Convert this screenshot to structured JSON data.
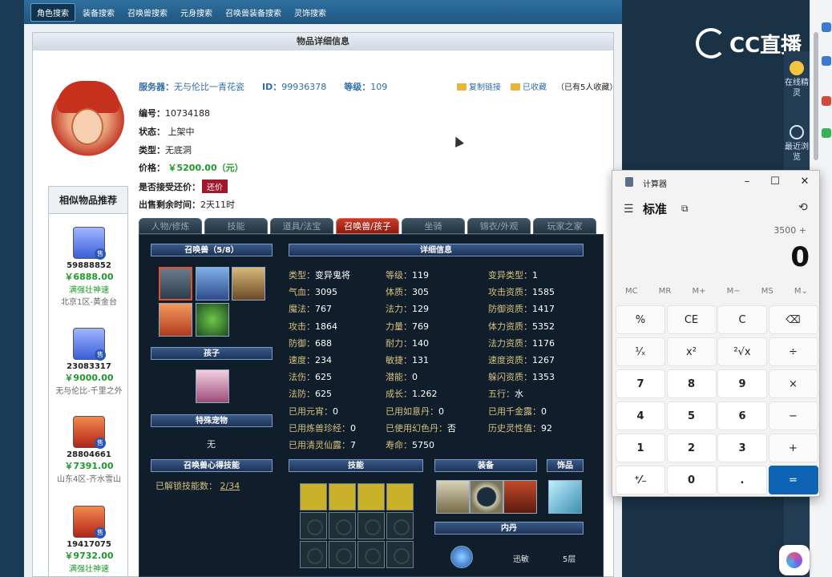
{
  "nav": {
    "tabs": [
      "角色搜索",
      "装备搜索",
      "召唤兽搜索",
      "元身搜索",
      "召唤兽装备搜索",
      "灵饰搜索"
    ],
    "active_index": 0
  },
  "panel": {
    "title": "物品详细信息"
  },
  "header": {
    "server_label": "服务器：",
    "server_value": "无与伦比一青花瓷",
    "id_label": "ID：",
    "id_value": "99936378",
    "level_label": "等级：",
    "level_value": "109",
    "copy_link": "复制链接",
    "favorited": "已收藏",
    "fav_count": "（已有5人收藏）"
  },
  "details": {
    "serial_label": "编号：",
    "serial_value": "10734188",
    "status_label": "状态：",
    "status_value": "上架中",
    "type_label": "类型：",
    "type_value": "无底洞",
    "price_label": "价格：",
    "price_value": "￥5200.00（元）",
    "bargain_label": "是否接受还价：",
    "bargain_button": "还价",
    "remaining_label": "出售剩余时间：",
    "remaining_value": "2天11时"
  },
  "similar": {
    "title": "相似物品推荐",
    "items": [
      {
        "id": "59888852",
        "price": "￥6888.00",
        "name": "满强壮神速",
        "server": "北京1区-黄金台"
      },
      {
        "id": "23083317",
        "price": "￥9000.00",
        "name": "",
        "server": "无与伦比-千里之外"
      },
      {
        "id": "28804661",
        "price": "￥7391.00",
        "name": "",
        "server": "山东4区-齐水雪山"
      },
      {
        "id": "19417075",
        "price": "￥9732.00",
        "name": "满强壮神速",
        "server": ""
      }
    ],
    "sell_badge": "售"
  },
  "game_tabs": [
    "人物/修炼",
    "技能",
    "道具/法宝",
    "召唤兽/孩子",
    "坐骑",
    "锦衣/外观",
    "玩家之家"
  ],
  "game_active_tab": 3,
  "sections": {
    "pets": "召唤兽（5/8）",
    "detail": "详细信息",
    "child": "孩子",
    "special_pet": "特殊宠物",
    "special_pet_value": "无",
    "pet_skill_head": "召唤兽心得技能",
    "unlocked_label": "已解锁技能数：",
    "unlocked_value": "2/34",
    "skills": "技能",
    "equip": "装备",
    "ornament": "饰品",
    "inner": "内丹",
    "inner_name": "迅敏",
    "inner_level": "5层"
  },
  "stats": {
    "col1": [
      [
        "类型：",
        "变异鬼将"
      ],
      [
        "气血：",
        "3095"
      ],
      [
        "魔法：",
        "767"
      ],
      [
        "攻击：",
        "1864"
      ],
      [
        "防御：",
        "688"
      ],
      [
        "速度：",
        "234"
      ],
      [
        "法伤：",
        "625"
      ],
      [
        "法防：",
        "625"
      ],
      [
        "已用元宵：",
        "0"
      ],
      [
        "已用炼兽珍经：",
        "0"
      ],
      [
        "已用清灵仙露：",
        "7"
      ]
    ],
    "col2": [
      [
        "等级：",
        "119"
      ],
      [
        "体质：",
        "305"
      ],
      [
        "法力：",
        "129"
      ],
      [
        "力量：",
        "769"
      ],
      [
        "耐力：",
        "140"
      ],
      [
        "敏捷：",
        "131"
      ],
      [
        "潜能：",
        "0"
      ],
      [
        "成长：",
        "1.262"
      ],
      [
        "已用如意丹：",
        "0"
      ],
      [
        "已使用幻色丹：",
        "否"
      ],
      [
        "寿命：",
        "5750"
      ]
    ],
    "col3": [
      [
        "变异类型：",
        "1"
      ],
      [
        "攻击资质：",
        "1585"
      ],
      [
        "防御资质：",
        "1417"
      ],
      [
        "体力资质：",
        "5352"
      ],
      [
        "法力资质：",
        "1176"
      ],
      [
        "速度资质：",
        "1267"
      ],
      [
        "躲闪资质：",
        "1353"
      ],
      [
        "五行：",
        "水"
      ],
      [
        "已用千金露：",
        "0"
      ],
      [
        "历史灵性值：",
        "92"
      ]
    ]
  },
  "calculator": {
    "title": "计算器",
    "mode": "标准",
    "expression": "3500 +",
    "display": "0",
    "memory": [
      "MC",
      "MR",
      "M+",
      "M−",
      "MS",
      "M⌄"
    ],
    "keys": [
      [
        "%",
        "CE",
        "C",
        "⌫"
      ],
      [
        "¹⁄ₓ",
        "x²",
        "²√x",
        "÷"
      ],
      [
        "7",
        "8",
        "9",
        "×"
      ],
      [
        "4",
        "5",
        "6",
        "−"
      ],
      [
        "1",
        "2",
        "3",
        "+"
      ],
      [
        "⁺⁄₋",
        "0",
        ".",
        "="
      ]
    ]
  },
  "overlay": {
    "brand": "CC直播",
    "online_sprite": "在线精灵",
    "recent_browse": "最近浏览"
  }
}
